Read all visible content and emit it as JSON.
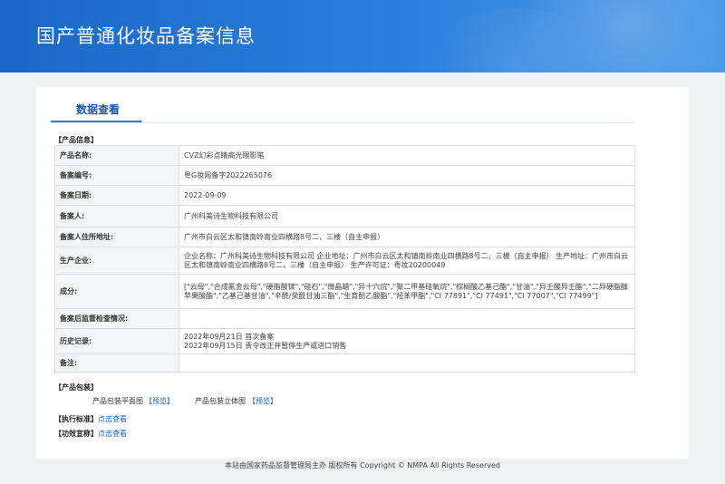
{
  "header": {
    "title": "国产普通化妆品备案信息"
  },
  "tabs": [
    {
      "label": "数据查看"
    }
  ],
  "product_info": {
    "section_title": "【产品信息】",
    "rows": [
      {
        "key": "产品名称:",
        "value": "CVZ幻彩点睛高光眼影笔"
      },
      {
        "key": "备案编号:",
        "value": "粤G妆网备字2022265076"
      },
      {
        "key": "备案日期:",
        "value": "2022-09-09"
      },
      {
        "key": "备案人:",
        "value": "广州科美诗生物科技有限公司"
      },
      {
        "key": "备案人住所地址:",
        "value": "广州市白云区太和镇南岭南业四横路8号二、三楼（自主申报）"
      },
      {
        "key": "生产企业:",
        "value": "企业名称：广州科美诗生物科技有限公司 企业地址：广州市白云区太和镇南岭南业四横路8号二、三楼（自主申报） 生产地址：广州市白云区太和镇南岭南业四横路8号二、三楼（自主申报） 生产许可证：粤妆20200049"
      },
      {
        "key": "成分:",
        "value": "[\"云母\",\"合成氟金云母\",\"硬脂酸镁\",\"硅石\",\"微晶蜡\",\"异十六烷\",\"聚二甲基硅氧烷\",\"棕榈酸乙基己酯\",\"甘油\",\"异壬酸异壬酯\",\"二异硬脂醇苹果酸酯\",\"乙基己基甘油\",\"辛酰/癸酰甘油三酯\",\"生育酚乙酸酯\",\"羟苯甲酯\",\"CI 77891\",\"CI 77491\",\"CI 77007\",\"CI 77499\"]"
      },
      {
        "key": "备案后监督检查情况:",
        "value": ""
      },
      {
        "key": "历史记录:",
        "value": "2022年09月21日 首次备案",
        "value2": "2022年09月15日 责令改正并暂停生产或进口销售"
      },
      {
        "key": "备注:",
        "value": ""
      }
    ]
  },
  "packaging": {
    "section_title": "【产品包装】",
    "flat_label": "产品包装平面图",
    "flat_link": "【预览】",
    "solid_label": "产品包装立体图",
    "solid_link": "【预览】"
  },
  "standard": {
    "label": "【执行标准】",
    "link": "点击查看"
  },
  "efficacy": {
    "label": "【功效宣称】",
    "link": "点击查看"
  },
  "footer": {
    "text": "本站由国家药品监督管理局主办 版权所有 Copyright © NMPA All Rights Reserved"
  }
}
